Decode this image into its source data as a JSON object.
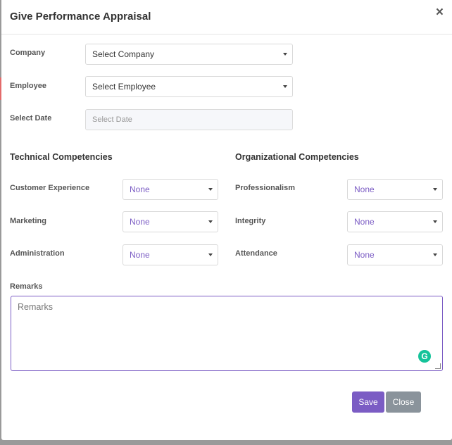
{
  "modal": {
    "title": "Give Performance Appraisal",
    "close_symbol": "×"
  },
  "fields": {
    "company_label": "Company",
    "company_value": "Select Company",
    "employee_label": "Employee",
    "employee_value": "Select Employee",
    "date_label": "Select Date",
    "date_placeholder": "Select Date"
  },
  "technical": {
    "title": "Technical Competencies",
    "items": [
      {
        "label": "Customer Experience",
        "value": "None"
      },
      {
        "label": "Marketing",
        "value": "None"
      },
      {
        "label": "Administration",
        "value": "None"
      }
    ]
  },
  "organizational": {
    "title": "Organizational Competencies",
    "items": [
      {
        "label": "Professionalism",
        "value": "None"
      },
      {
        "label": "Integrity",
        "value": "None"
      },
      {
        "label": "Attendance",
        "value": "None"
      }
    ]
  },
  "remarks": {
    "label": "Remarks",
    "placeholder": "Remarks"
  },
  "buttons": {
    "save": "Save",
    "close": "Close"
  },
  "colors": {
    "accent": "#7b5cc4",
    "close_button": "#8a939b",
    "grammarly": "#15c39a"
  }
}
